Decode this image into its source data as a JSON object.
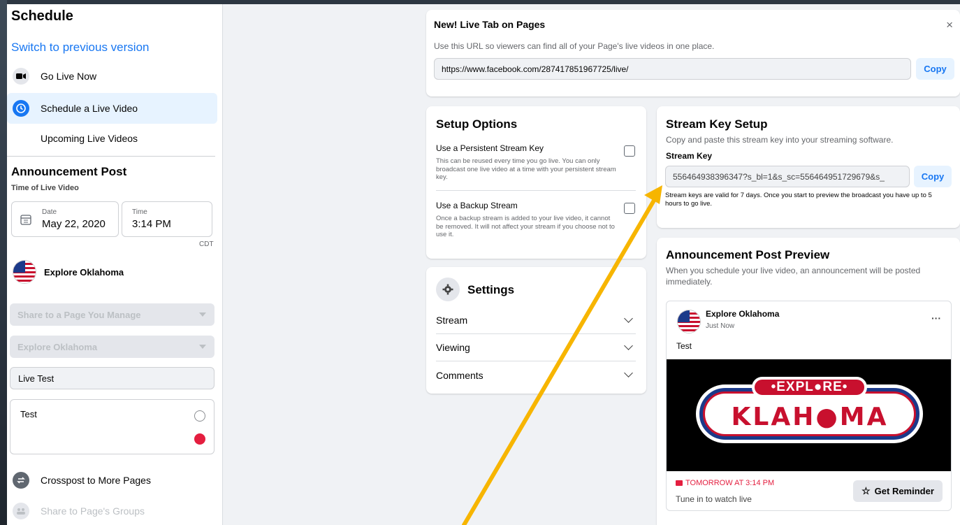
{
  "sidebar": {
    "title": "Schedule",
    "switch_link": "Switch to previous version",
    "items": [
      {
        "label": "Go Live Now",
        "icon": "camera-icon"
      },
      {
        "label": "Schedule a Live Video",
        "icon": "clock-icon"
      },
      {
        "label": "Upcoming Live Videos",
        "icon": ""
      }
    ],
    "announcement_heading": "Announcement Post",
    "time_label": "Time of Live Video",
    "date_label": "Date",
    "date_value": "May 22, 2020",
    "time_field_label": "Time",
    "time_value": "3:14 PM",
    "timezone": "CDT",
    "page_name": "Explore Oklahoma",
    "share_dropdown": "Share to a Page You Manage",
    "page_dropdown": "Explore Oklahoma",
    "title_value": "Live Test",
    "description_value": "Test",
    "crosspost_label": "Crosspost to More Pages",
    "groups_label": "Share to Page's Groups"
  },
  "live_tab": {
    "title": "New! Live Tab on Pages",
    "description": "Use this URL so viewers can find all of your Page's live videos in one place.",
    "url": "https://www.facebook.com/287417851967725/live/",
    "copy_label": "Copy",
    "close_label": "×"
  },
  "setup_options": {
    "title": "Setup Options",
    "persistent_title": "Use a Persistent Stream Key",
    "persistent_desc": "This can be reused every time you go live. You can only broadcast one live video at a time with your persistent stream key.",
    "backup_title": "Use a Backup Stream",
    "backup_desc": "Once a backup stream is added to your live video, it cannot be removed. It will not affect your stream if you choose not to use it."
  },
  "settings": {
    "title": "Settings",
    "rows": [
      "Stream",
      "Viewing",
      "Comments"
    ]
  },
  "stream_key": {
    "title": "Stream Key Setup",
    "description": "Copy and paste this stream key into your streaming software.",
    "label": "Stream Key",
    "value": "556464938396347?s_bl=1&s_sc=556464951729679&s_",
    "copy_label": "Copy",
    "validity": "Stream keys are valid for 7 days. Once you start to preview the broadcast you have up to 5 hours to go live."
  },
  "preview": {
    "title": "Announcement Post Preview",
    "description": "When you schedule your live video, an announcement will be posted immediately.",
    "page_name": "Explore Oklahoma",
    "timestamp": "Just Now",
    "more": "···",
    "post_text": "Test",
    "logo_top": "•EXPL●RE•",
    "logo_bottom": "KLAH●MA",
    "when": "TOMORROW AT 3:14 PM",
    "tune_in": "Tune in to watch live",
    "reminder_label": "Get Reminder"
  },
  "colors": {
    "accent": "#1877f2",
    "live_red": "#e41e3f",
    "arrow": "#f7b500"
  }
}
